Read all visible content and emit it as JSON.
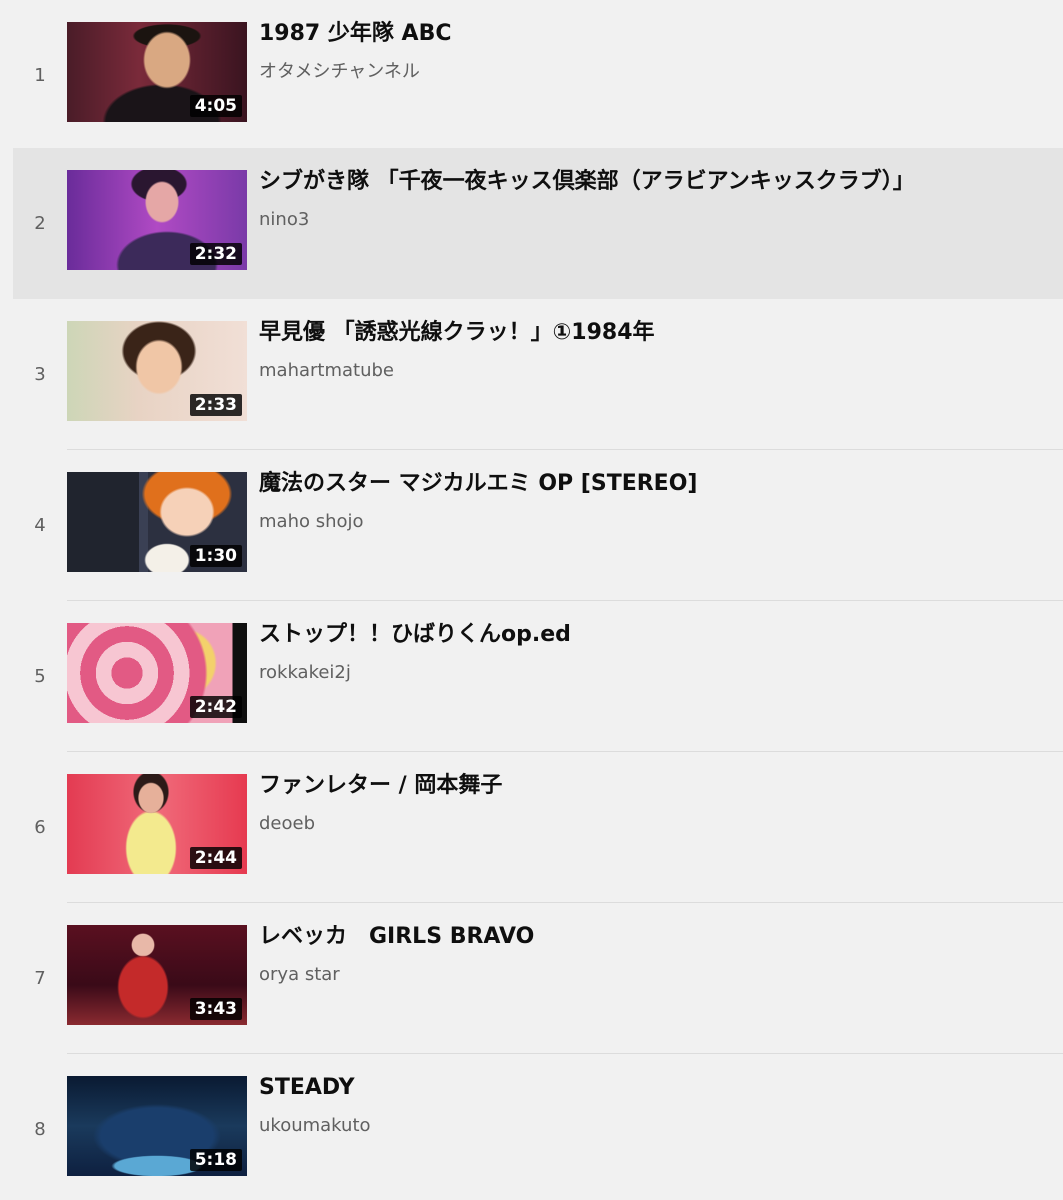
{
  "playlist": {
    "items": [
      {
        "index": "1",
        "title": "1987 少年隊 ABC",
        "channel": "オタメシチャンネル",
        "duration": "4:05",
        "thumbnail": "performer-singing"
      },
      {
        "index": "2",
        "title": "シブがき隊 「千夜一夜キッス倶楽部（アラビアンキッスクラブ）」",
        "channel": "nino3",
        "duration": "2:32",
        "thumbnail": "performer-purple-stage",
        "selected": true
      },
      {
        "index": "3",
        "title": "早見優 「誘惑光線クラッ！」①1984年",
        "channel": "mahartmatube",
        "duration": "2:33",
        "thumbnail": "singer-smiling"
      },
      {
        "index": "4",
        "title": "魔法のスター マジカルエミ OP [STEREO]",
        "channel": "maho shojo",
        "duration": "1:30",
        "thumbnail": "anime-girl"
      },
      {
        "index": "5",
        "title": "ストップ！！ひばりくんop.ed",
        "channel": "rokkakei2j",
        "duration": "2:42",
        "thumbnail": "anime-pink"
      },
      {
        "index": "6",
        "title": "ファンレター / 岡本舞子",
        "channel": "deoeb",
        "duration": "2:44",
        "thumbnail": "singer-yellow-dress"
      },
      {
        "index": "7",
        "title": "レベッカ　GIRLS BRAVO",
        "channel": "orya star",
        "duration": "3:43",
        "thumbnail": "singer-red-stage"
      },
      {
        "index": "8",
        "title": "STEADY",
        "channel": "ukoumakuto",
        "duration": "5:18",
        "thumbnail": "concert-stage-blue"
      }
    ]
  }
}
